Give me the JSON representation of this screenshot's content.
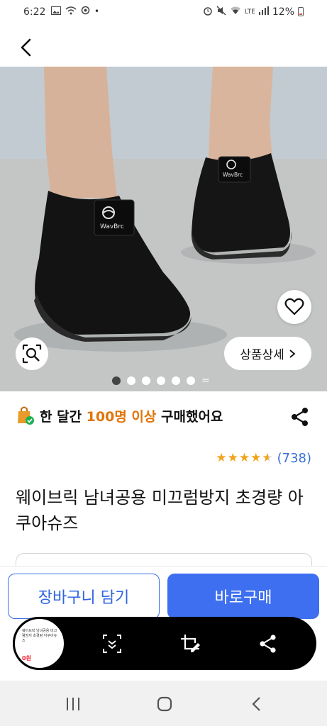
{
  "status": {
    "time": "6:22",
    "battery": "12%",
    "network": "LTE"
  },
  "product": {
    "buy_count_prefix": "한 달간 ",
    "buy_count_highlight": "100명 이상",
    "buy_count_suffix": " 구매했어요",
    "review_count": "(738)",
    "rating": 4.5,
    "title": "웨이브릭 남녀공용 미끄럼방지 초경량 아쿠아슈즈",
    "brand_on_shoe": "WavBrc",
    "image_count": 6,
    "current_image": 1
  },
  "actions": {
    "detail_label": "상품상세",
    "cart_label": "장바구니 담기",
    "buy_label": "바로구매"
  },
  "thumbnail": {
    "text": "웨이브릭 남녀공용 미끄럼방지 초경량 아쿠아슈즈",
    "price_hint": "0원"
  },
  "colors": {
    "accent_blue": "#3d6ff0",
    "highlight_orange": "#e0750a",
    "star": "#f3a21b"
  }
}
